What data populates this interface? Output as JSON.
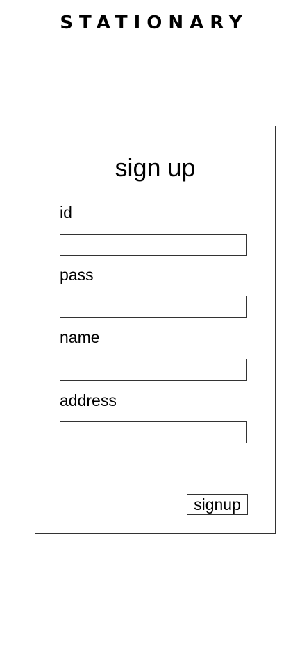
{
  "header": {
    "brand": "STATIONARY"
  },
  "form": {
    "title": "sign up",
    "fields": [
      {
        "label": "id",
        "value": "",
        "placeholder": ""
      },
      {
        "label": "pass",
        "value": "",
        "placeholder": ""
      },
      {
        "label": "name",
        "value": "",
        "placeholder": ""
      },
      {
        "label": "address",
        "value": "",
        "placeholder": ""
      }
    ],
    "submit_label": "signup"
  }
}
